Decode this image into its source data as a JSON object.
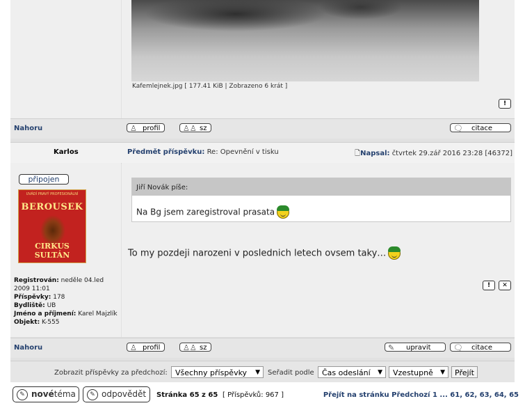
{
  "attachment": {
    "caption": "Kafemlejnek.jpg [ 177.41 KiB | Zobrazeno 6 krát ]",
    "report_icon": "!"
  },
  "post_bar_1": {
    "nahoru": "Nahoru",
    "profile_label": "profil",
    "pm_label": "sz",
    "quote_label": "citace"
  },
  "post": {
    "author": "Karlos",
    "subject_label": "Předmět příspěvku:",
    "subject": "Re: Opevnění v tisku",
    "posted_label": "Napsal:",
    "posted": "čtvrtek 29.zář 2016 23:28 [46372]",
    "online_badge": "připojen",
    "avatar": {
      "top_text": "UVÁDÍ PRAVÝ PROFESIONÁLNÍ",
      "name": "BEROUSEK",
      "bottom": "CIRKUS SULTÁN"
    },
    "profile": {
      "registered_label": "Registrován:",
      "registered": "neděle 04.led 2009 11:01",
      "posts_label": "Příspěvky:",
      "posts": "178",
      "residence_label": "Bydliště:",
      "residence": "UB",
      "realname_label": "Jméno a příjmení:",
      "realname": "Karel Majzlík",
      "object_label": "Objekt:",
      "object": "K-555"
    },
    "quote_author": "Jiří Novák píše:",
    "quote_text": "Na Bg jsem zaregistroval prasata",
    "message": "To my pozdeji narozeni v poslednich letech ovsem taky…",
    "report_icon": "!",
    "delete_icon": "✕"
  },
  "post_bar_2": {
    "nahoru": "Nahoru",
    "profile_label": "profil",
    "pm_label": "sz",
    "edit_label": "upravit",
    "quote_label": "citace"
  },
  "filter": {
    "show_label": "Zobrazit příspěvky za předchozí:",
    "show_value": "Všechny příspěvky",
    "sort_label": "Seřadit podle",
    "sort_value": "Čas odeslání",
    "order_value": "Vzestupně",
    "go_label": "Přejít"
  },
  "footer": {
    "new_topic_bold": "nové",
    "new_topic_rest": "téma",
    "reply_label": "odpovědět",
    "page_info": "Stránka 65 z 65",
    "posts_count": "[ Příspěvků: 967 ]",
    "pager": "Přejít na stránku Předchozí  1 ... 61, 62, 63, 64, 65"
  }
}
